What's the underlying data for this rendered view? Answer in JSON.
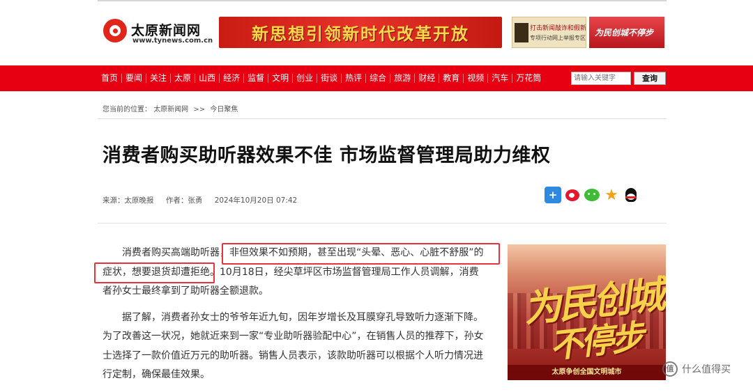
{
  "header": {
    "logo_name": "太原新闻网",
    "logo_url": "www.tynews.com.cn",
    "banner_main": "新思想引领新时代改革开放",
    "banner_b_line1": "打击新闻敲诈和假新闻",
    "banner_b_line2": "专项行动网上举报专区",
    "banner_c": "为民创城不停步"
  },
  "nav": {
    "items": [
      "首页",
      "要闻",
      "关注",
      "太原",
      "山西",
      "经济",
      "监督",
      "文明",
      "创业",
      "街谈",
      "热评",
      "综合",
      "旅游",
      "财经",
      "教育",
      "视频",
      "汽车",
      "万花筒"
    ],
    "search_placeholder": "请输入关键字",
    "search_button": "查询"
  },
  "breadcrumb": {
    "label": "您当前的位置：",
    "home": "太原新闻网",
    "sep": ">>",
    "current": "今日聚焦"
  },
  "article": {
    "title": "消费者购买助听器效果不佳 市场监督管理局助力维权",
    "source": "来源：太原晚报",
    "author": "作者：张勇",
    "datetime": "2024年10月20日 07:42",
    "paragraphs": [
      "消费者购买高端助听器，非但效果不如预期，甚至出现“头晕、恶心、心脏不舒服”的症状，想要退货却遭拒绝。10月18日，经尖草坪区市场监督管理局工作人员调解，消费者孙女士最终拿到了助听器全额退款。",
      "据了解，消费者孙女士的爷爷年近九旬，因年岁增长及耳膜穿孔导致听力逐渐下降。为了改善这一状况，她就近来到一家“专业助听器验配中心”，在销售人员的推荐下，孙女士选择了一款价值近万元的助听器。销售人员表示，该款助听器可以根据个人听力情况进行定制，确保最佳效果。"
    ]
  },
  "share": {
    "icons": [
      "plus-share-icon",
      "weibo-icon",
      "wechat-icon",
      "favorite-star-icon",
      "qq-icon"
    ]
  },
  "side_ad": {
    "calligraphy_line1": "为民创城",
    "calligraphy_line2": "不停步",
    "footer": "太原争创全国文明城市"
  },
  "watermark": {
    "logo_text": "值",
    "text": "什么值得买"
  },
  "colors": {
    "brand_red": "#e60012",
    "highlight_red": "#e8333f"
  }
}
